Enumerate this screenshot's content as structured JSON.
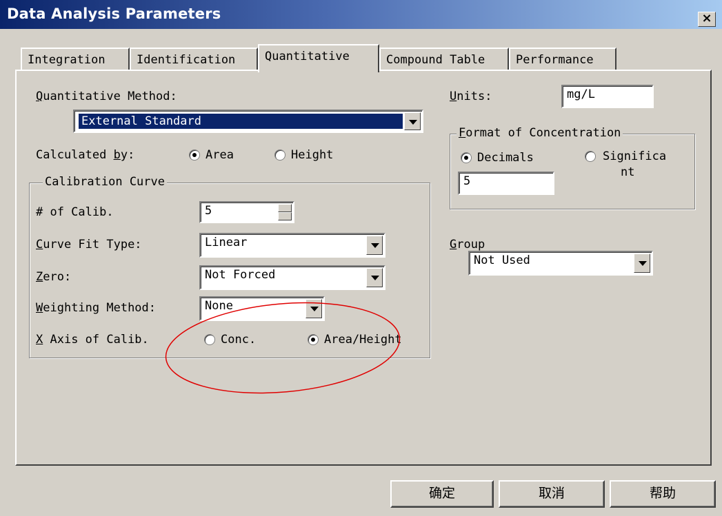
{
  "window": {
    "title": "Data Analysis Parameters",
    "close": "×"
  },
  "tabs": [
    "Integration",
    "Identification",
    "Quantitative",
    "Compound Table",
    "Performance"
  ],
  "quant_method": {
    "label_key": "Q",
    "label_rest": "uantitative Method:",
    "value": "External Standard"
  },
  "calculated_by": {
    "label_pre": "Calculated ",
    "label_key": "b",
    "label_post": "y:",
    "options": [
      "Area",
      "Height"
    ],
    "selected": "Area"
  },
  "calibration": {
    "legend": "Calibration Curve",
    "num_calib": {
      "label": "# of Calib.",
      "value": "5"
    },
    "curve_fit": {
      "label_key": "C",
      "label_rest": "urve Fit Type:",
      "value": "Linear"
    },
    "zero": {
      "label_key": "Z",
      "label_rest": "ero:",
      "value": "Not Forced"
    },
    "weighting": {
      "label_key": "W",
      "label_rest": "eighting Method:",
      "value": "None"
    },
    "x_axis": {
      "label_key": "X",
      "label_rest": " Axis of Calib.",
      "options": [
        "Conc.",
        "Area/Height"
      ],
      "selected": "Area/Height"
    }
  },
  "units": {
    "label_key": "U",
    "label_rest": "nits",
    "value": "mg/L"
  },
  "format": {
    "legend_key": "F",
    "legend_rest": "ormat of Concentration",
    "options": [
      "Decimals",
      "Significa",
      "nt"
    ],
    "selected": "Decimals",
    "value": "5"
  },
  "group": {
    "label_key": "G",
    "label_rest": "roup",
    "value": "Not Used"
  },
  "buttons": {
    "ok": "确定",
    "cancel": "取消",
    "help": "帮助"
  },
  "colors": {
    "face": "#d4d0c8",
    "title_start": "#0a246a",
    "title_end": "#a6caf0",
    "selection": "#0a246a",
    "annotation": "#e00000"
  }
}
